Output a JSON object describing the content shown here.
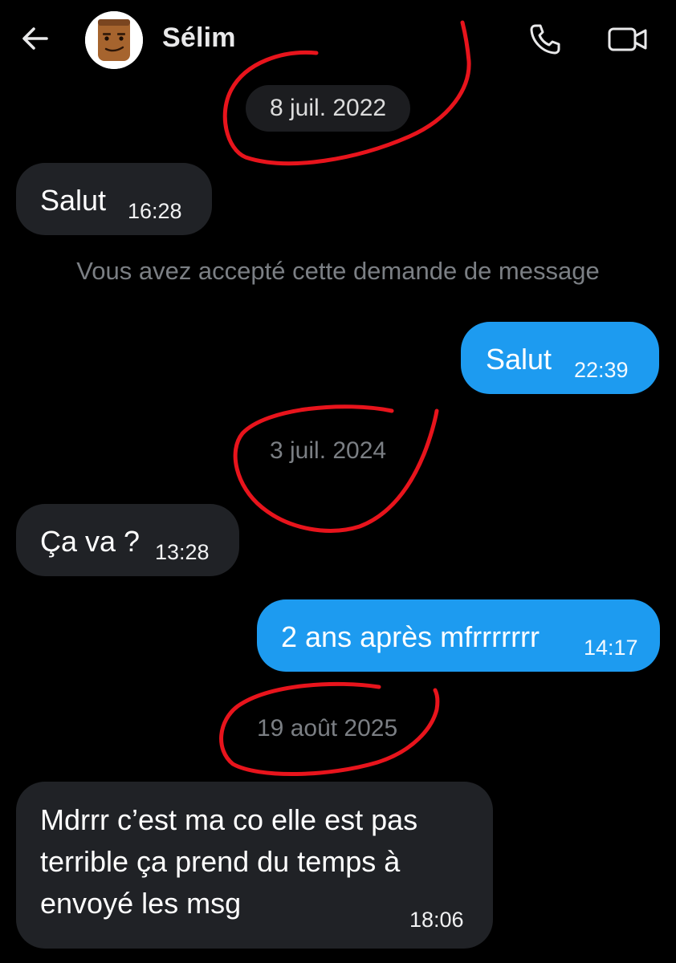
{
  "header": {
    "contact_name": "Sélim",
    "back_icon": "arrow-left-icon",
    "call_icon": "phone-icon",
    "video_icon": "video-camera-icon"
  },
  "conversation": {
    "dates": [
      "8 juil. 2022",
      "3 juil. 2024",
      "19 août 2025"
    ],
    "system_note": "Vous avez accepté cette demande de message",
    "messages": [
      {
        "direction": "received",
        "text": "Salut",
        "time": "16:28"
      },
      {
        "direction": "sent",
        "text": "Salut",
        "time": "22:39"
      },
      {
        "direction": "received",
        "text": "Ça va ?",
        "time": "13:28"
      },
      {
        "direction": "sent",
        "text": "2 ans après mfrrrrrrr",
        "time": "14:17"
      },
      {
        "direction": "received",
        "text": "Mdrrr c’est ma co elle est pas terrible ça prend du temps à envoyé les msg",
        "time": "18:06"
      }
    ]
  },
  "colors": {
    "background": "#000000",
    "sent_bubble": "#1d9bf0",
    "received_bubble": "#202226",
    "annotation": "#e8141c"
  }
}
